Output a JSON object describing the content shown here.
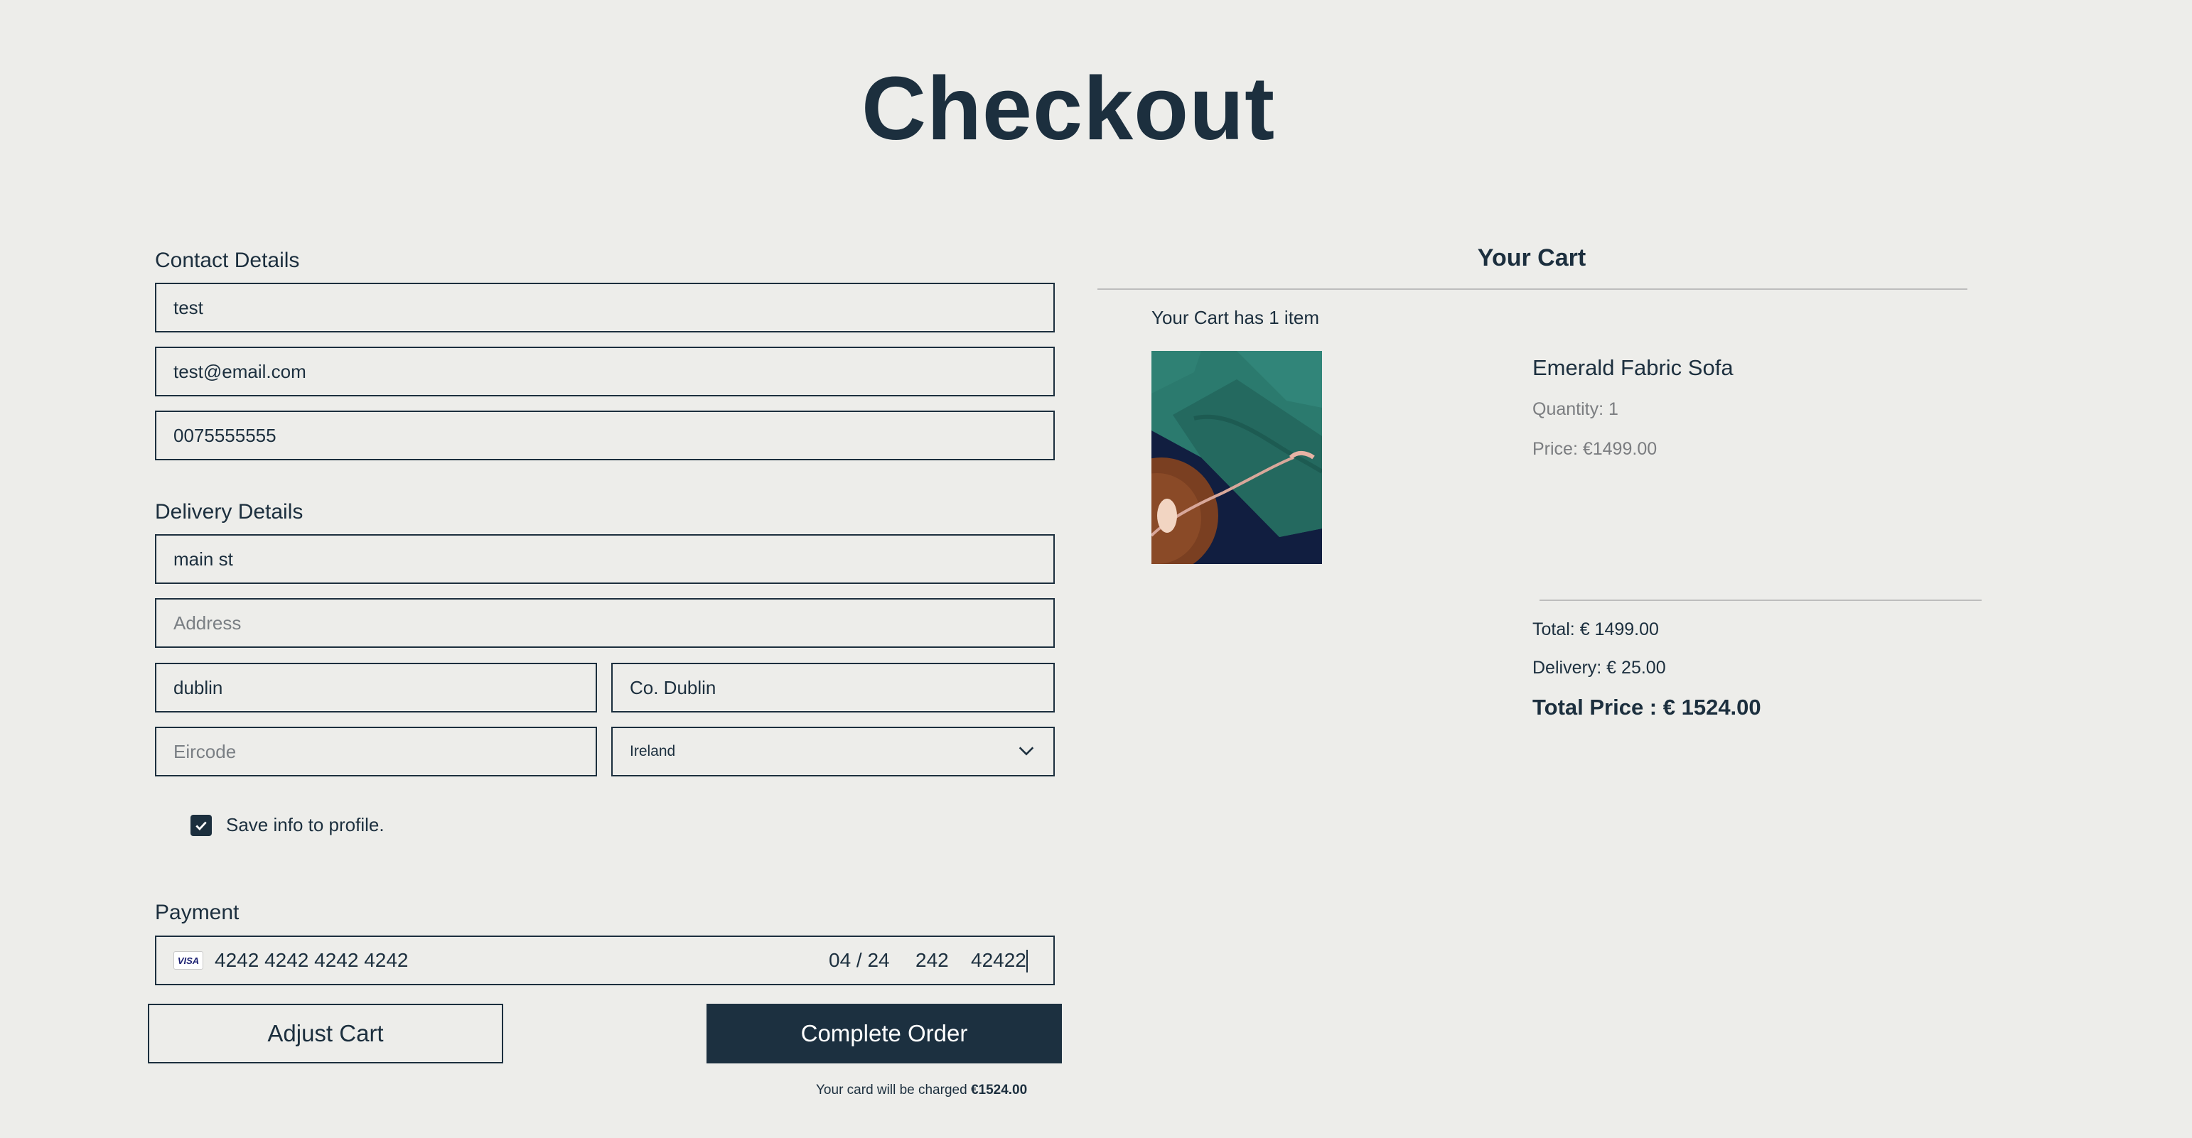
{
  "page": {
    "title": "Checkout"
  },
  "contact": {
    "label": "Contact Details",
    "name_value": "test",
    "email_value": "test@email.com",
    "phone_value": "0075555555"
  },
  "delivery": {
    "label": "Delivery Details",
    "street_value": "main st",
    "address_placeholder": "Address",
    "address_value": "",
    "city_value": "dublin",
    "county_value": "Co. Dublin",
    "eircode_placeholder": "Eircode",
    "eircode_value": "",
    "country_selected": "Ireland",
    "save_info_label": "Save info to profile.",
    "save_info_checked": true
  },
  "payment": {
    "label": "Payment",
    "card_brand": "VISA",
    "card_number": "4242 4242 4242 4242",
    "expiry": "04 / 24",
    "cvc": "242",
    "postal": "42422"
  },
  "actions": {
    "adjust_cart_label": "Adjust Cart",
    "complete_order_label": "Complete Order",
    "charge_note_prefix": "Your card will be charged",
    "charge_amount": "€1524.00"
  },
  "cart": {
    "title": "Your Cart",
    "count_text": "Your Cart has 1 item",
    "item": {
      "name": "Emerald Fabric Sofa",
      "quantity_text": "Quantity: 1",
      "price_text": "Price: €1499.00",
      "image_icon": "sofa-image"
    },
    "total_text": "Total: € 1499.00",
    "delivery_text": "Delivery: € 25.00",
    "grand_total_text": "Total Price : € 1524.00"
  },
  "colors": {
    "background": "#ededea",
    "primary": "#1c2f3e",
    "muted_text": "#7b7d80",
    "divider": "#bdbdbd"
  }
}
